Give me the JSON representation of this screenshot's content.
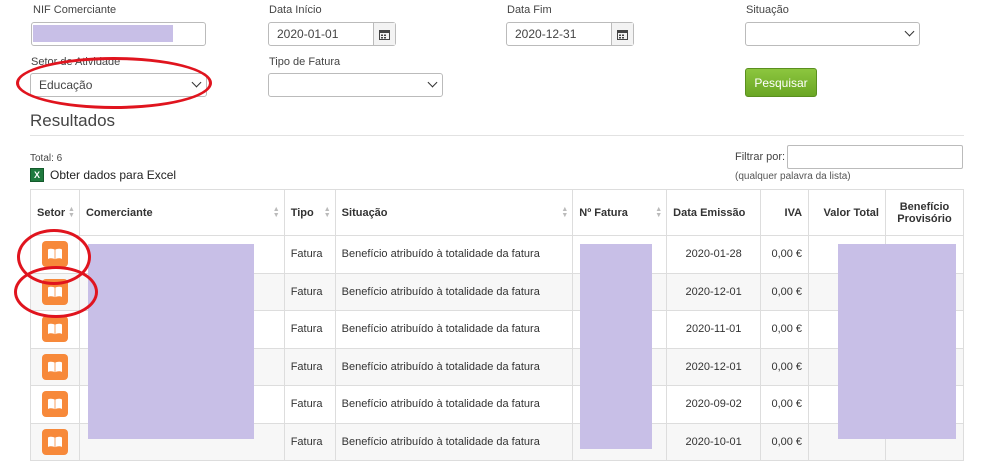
{
  "filters": {
    "nif_label": "NIF Comerciante",
    "data_inicio_label": "Data Início",
    "data_inicio_value": "2020-01-01",
    "data_fim_label": "Data Fim",
    "data_fim_value": "2020-12-31",
    "situacao_label": "Situação",
    "situacao_value": "",
    "setor_label": "Setor de Atividade",
    "setor_value": "Educação",
    "tipo_fatura_label": "Tipo de Fatura",
    "tipo_fatura_value": "",
    "search_label": "Pesquisar"
  },
  "results": {
    "title": "Resultados",
    "total": "Total: 6",
    "excel_label": "Obter dados para Excel",
    "filter_label": "Filtrar por:",
    "filter_hint": "(qualquer palavra da lista)",
    "columns": [
      "Setor",
      "Comerciante",
      "Tipo",
      "Situação",
      "Nº Fatura",
      "Data Emissão",
      "IVA",
      "Valor Total",
      "Benefício Provisório"
    ],
    "rows": [
      {
        "tipo": "Fatura",
        "situacao": "Benefício atribuído à totalidade da fatura",
        "data": "2020-01-28",
        "iva": "0,00 €"
      },
      {
        "tipo": "Fatura",
        "situacao": "Benefício atribuído à totalidade da fatura",
        "data": "2020-12-01",
        "iva": "0,00 €"
      },
      {
        "tipo": "Fatura",
        "situacao": "Benefício atribuído à totalidade da fatura",
        "data": "2020-11-01",
        "iva": "0,00 €"
      },
      {
        "tipo": "Fatura",
        "situacao": "Benefício atribuído à totalidade da fatura",
        "data": "2020-12-01",
        "iva": "0,00 €"
      },
      {
        "tipo": "Fatura",
        "situacao": "Benefício atribuído à totalidade da fatura",
        "data": "2020-09-02",
        "iva": "0,00 €"
      },
      {
        "tipo": "Fatura",
        "situacao": "Benefício atribuído à totalidade da fatura",
        "data": "2020-10-01",
        "iva": "0,00 €"
      }
    ]
  },
  "icons": {
    "calendar": "calendar-icon",
    "excel": "excel-icon",
    "setor": "book-icon"
  },
  "colors": {
    "search_button": "#7ab531",
    "setor_icon": "#f7893a",
    "annotation": "#e0141e",
    "redaction": "#c8bfe7"
  }
}
